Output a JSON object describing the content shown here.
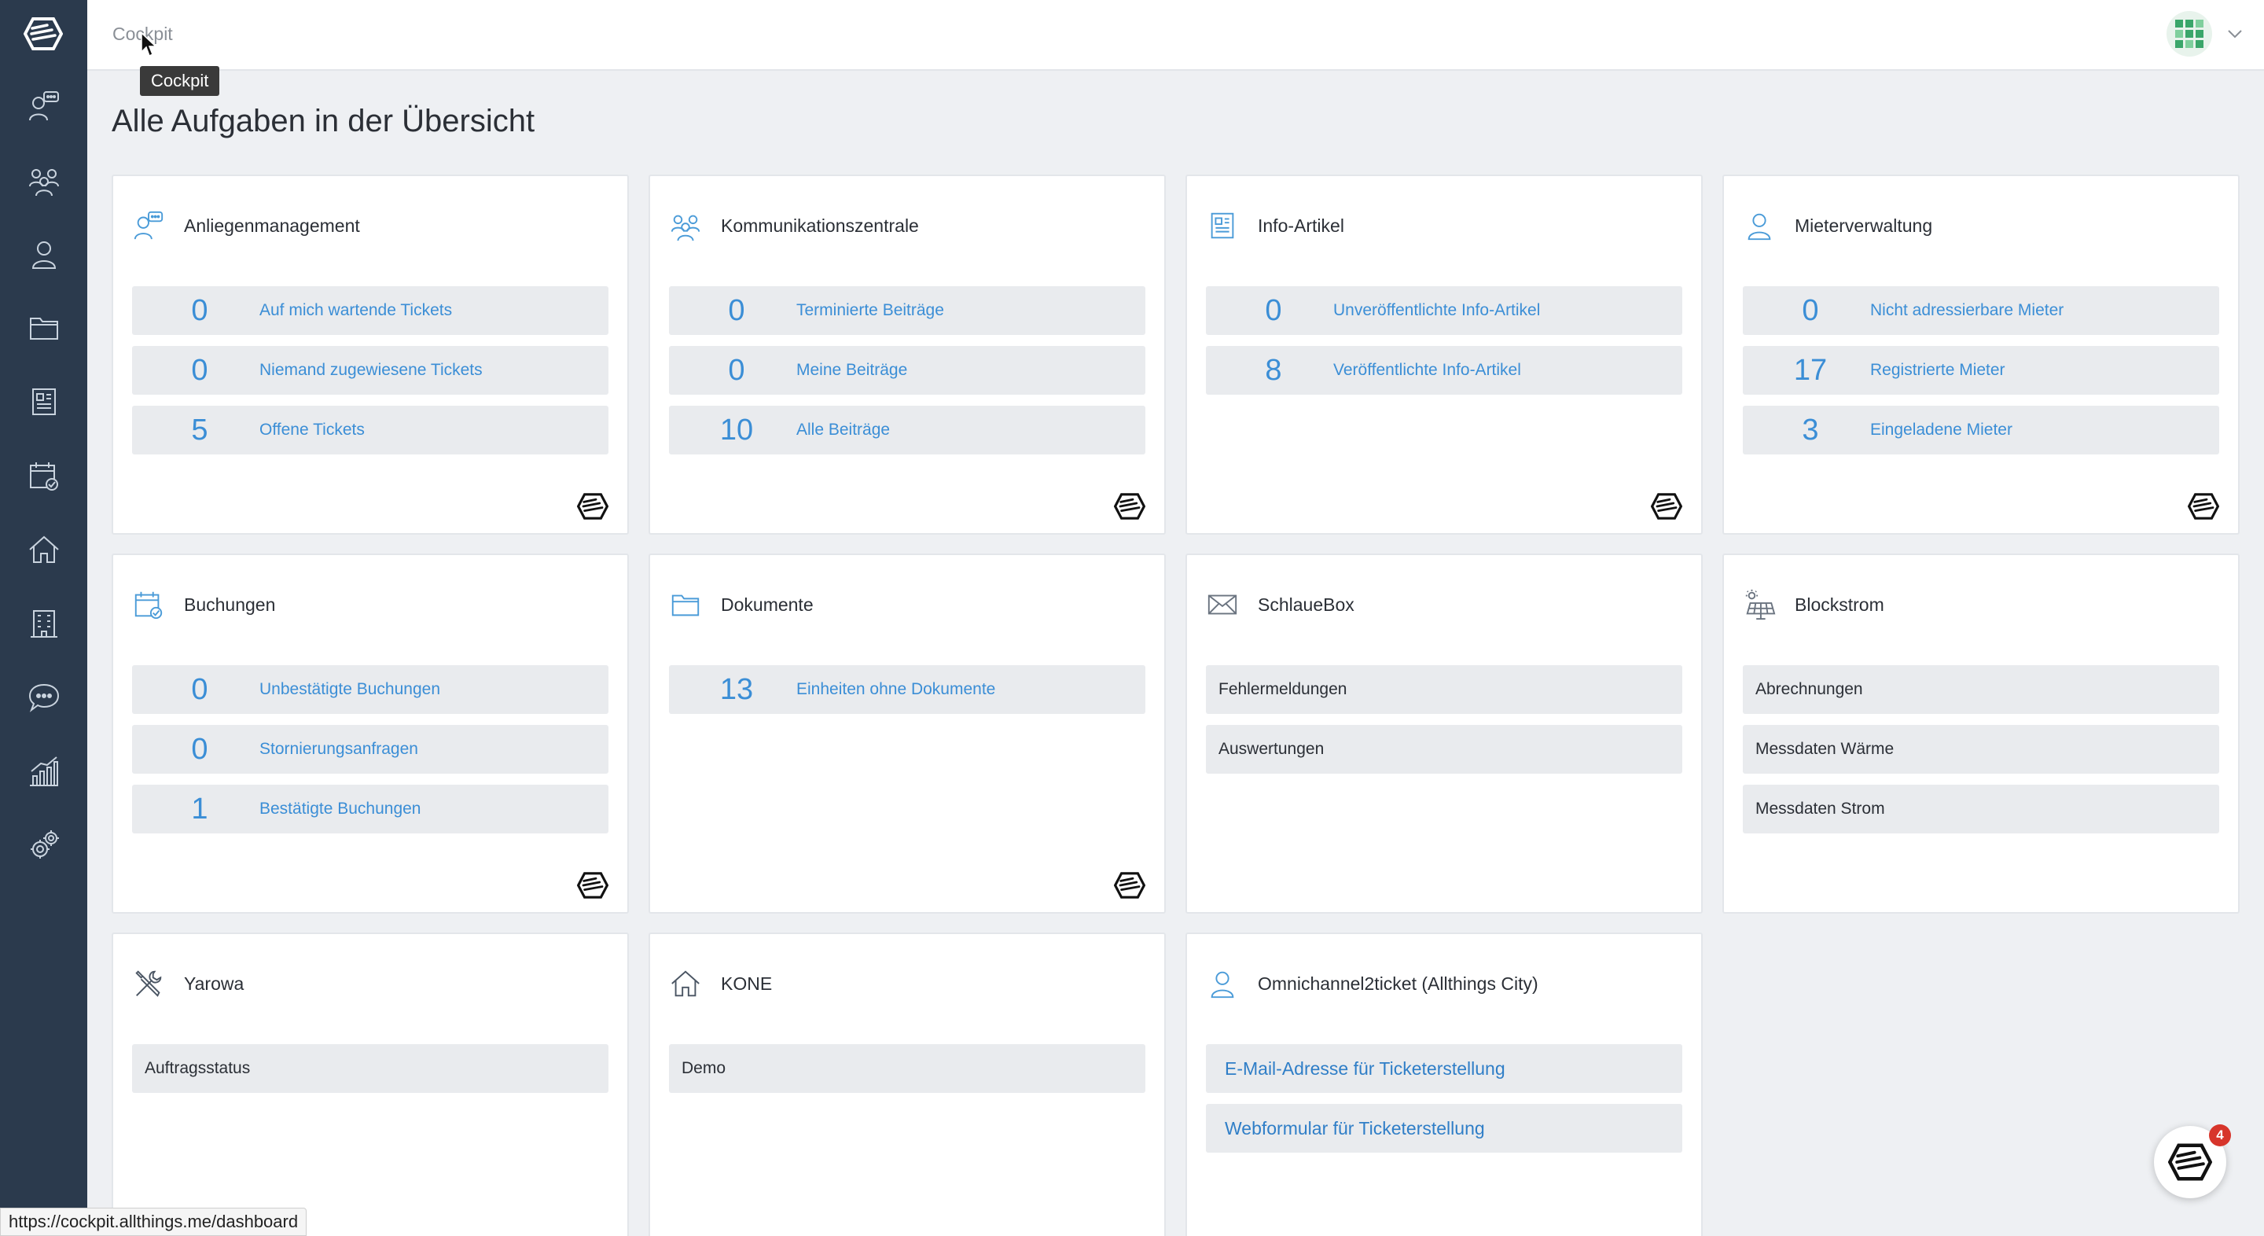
{
  "header": {
    "breadcrumb": "Cockpit",
    "tooltip": "Cockpit"
  },
  "page": {
    "title": "Alle Aufgaben in der Übersicht"
  },
  "sidebar": {
    "items": [
      {
        "icon": "support-agent-icon"
      },
      {
        "icon": "community-icon"
      },
      {
        "icon": "tenant-icon"
      },
      {
        "icon": "folder-icon"
      },
      {
        "icon": "article-icon"
      },
      {
        "icon": "calendar-check-icon"
      },
      {
        "icon": "home-icon"
      },
      {
        "icon": "building-icon"
      },
      {
        "icon": "chat-bubble-icon"
      },
      {
        "icon": "analytics-icon"
      },
      {
        "icon": "settings-gears-icon"
      }
    ]
  },
  "cards": {
    "anliegen": {
      "title": "Anliegenmanagement",
      "rows": [
        {
          "num": "0",
          "label": "Auf mich wartende Tickets"
        },
        {
          "num": "0",
          "label": "Niemand zugewiesene Tickets"
        },
        {
          "num": "5",
          "label": "Offene Tickets"
        }
      ]
    },
    "kommunikation": {
      "title": "Kommunikationszentrale",
      "rows": [
        {
          "num": "0",
          "label": "Terminierte Beiträge"
        },
        {
          "num": "0",
          "label": "Meine Beiträge"
        },
        {
          "num": "10",
          "label": "Alle Beiträge"
        }
      ]
    },
    "info": {
      "title": "Info-Artikel",
      "rows": [
        {
          "num": "0",
          "label": "Unveröffentlichte Info-Artikel"
        },
        {
          "num": "8",
          "label": "Veröffentlichte Info-Artikel"
        }
      ]
    },
    "mieter": {
      "title": "Mieterverwaltung",
      "rows": [
        {
          "num": "0",
          "label": "Nicht adressierbare Mieter"
        },
        {
          "num": "17",
          "label": "Registrierte Mieter"
        },
        {
          "num": "3",
          "label": "Eingeladene Mieter"
        }
      ]
    },
    "buchungen": {
      "title": "Buchungen",
      "rows": [
        {
          "num": "0",
          "label": "Unbestätigte Buchungen"
        },
        {
          "num": "0",
          "label": "Stornierungsanfragen"
        },
        {
          "num": "1",
          "label": "Bestätigte Buchungen"
        }
      ]
    },
    "dokumente": {
      "title": "Dokumente",
      "rows": [
        {
          "num": "13",
          "label": "Einheiten ohne Dokumente"
        }
      ]
    },
    "schlauebox": {
      "title": "SchlaueBox",
      "rows": [
        "Fehlermeldungen",
        "Auswertungen"
      ]
    },
    "blockstrom": {
      "title": "Blockstrom",
      "rows": [
        "Abrechnungen",
        "Messdaten Wärme",
        "Messdaten Strom"
      ]
    },
    "yarowa": {
      "title": "Yarowa",
      "rows": [
        "Auftragsstatus"
      ]
    },
    "kone": {
      "title": "KONE",
      "rows": [
        "Demo"
      ]
    },
    "omni": {
      "title": "Omnichannel2ticket (Allthings City)",
      "rows": [
        "E-Mail-Adresse für Ticketerstellung",
        "Webformular für Ticketerstellung"
      ]
    }
  },
  "statusbar": {
    "url": "https://cockpit.allthings.me/dashboard"
  },
  "chat": {
    "badge": "4"
  },
  "colors": {
    "sidebar": "#2b3a4d",
    "accent": "#3b8ed6",
    "icon": "#4a9bd8",
    "badge": "#d7352b"
  }
}
